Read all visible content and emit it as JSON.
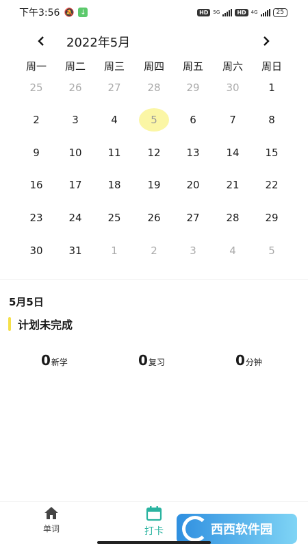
{
  "status": {
    "time": "下午3:56",
    "net_1": "5G",
    "net_2": "4G",
    "hd": "HD",
    "battery": "25"
  },
  "calendar": {
    "title": "2022年5月",
    "prev_arrow": "‹",
    "next_arrow": "›",
    "weekdays": [
      "周一",
      "周二",
      "周三",
      "周四",
      "周五",
      "周六",
      "周日"
    ],
    "selected_day": "5",
    "weeks": [
      [
        {
          "d": "25",
          "o": true
        },
        {
          "d": "26",
          "o": true
        },
        {
          "d": "27",
          "o": true
        },
        {
          "d": "28",
          "o": true
        },
        {
          "d": "29",
          "o": true
        },
        {
          "d": "30",
          "o": true
        },
        {
          "d": "1",
          "o": false
        }
      ],
      [
        {
          "d": "2",
          "o": false
        },
        {
          "d": "3",
          "o": false
        },
        {
          "d": "4",
          "o": false
        },
        {
          "d": "5",
          "o": false,
          "s": true
        },
        {
          "d": "6",
          "o": false
        },
        {
          "d": "7",
          "o": false
        },
        {
          "d": "8",
          "o": false
        }
      ],
      [
        {
          "d": "9",
          "o": false
        },
        {
          "d": "10",
          "o": false
        },
        {
          "d": "11",
          "o": false
        },
        {
          "d": "12",
          "o": false
        },
        {
          "d": "13",
          "o": false
        },
        {
          "d": "14",
          "o": false
        },
        {
          "d": "15",
          "o": false
        }
      ],
      [
        {
          "d": "16",
          "o": false
        },
        {
          "d": "17",
          "o": false
        },
        {
          "d": "18",
          "o": false
        },
        {
          "d": "19",
          "o": false
        },
        {
          "d": "20",
          "o": false
        },
        {
          "d": "21",
          "o": false
        },
        {
          "d": "22",
          "o": false
        }
      ],
      [
        {
          "d": "23",
          "o": false
        },
        {
          "d": "24",
          "o": false
        },
        {
          "d": "25",
          "o": false
        },
        {
          "d": "26",
          "o": false
        },
        {
          "d": "27",
          "o": false
        },
        {
          "d": "28",
          "o": false
        },
        {
          "d": "29",
          "o": false
        }
      ],
      [
        {
          "d": "30",
          "o": false
        },
        {
          "d": "31",
          "o": false
        },
        {
          "d": "1",
          "o": true
        },
        {
          "d": "2",
          "o": true
        },
        {
          "d": "3",
          "o": true
        },
        {
          "d": "4",
          "o": true
        },
        {
          "d": "5",
          "o": true
        }
      ]
    ]
  },
  "detail": {
    "date_label": "5月5日",
    "plan_status": "计划未完成",
    "stats": [
      {
        "value": "0",
        "unit": "新学"
      },
      {
        "value": "0",
        "unit": "复习"
      },
      {
        "value": "0",
        "unit": "分钟"
      }
    ]
  },
  "tabs": [
    {
      "label": "单词",
      "icon": "home-icon"
    },
    {
      "label": "打卡",
      "icon": "calendar-icon"
    }
  ],
  "watermark": {
    "text": "西西软件园"
  },
  "colors": {
    "accent": "#2ab3a0",
    "selected": "#fbf6a5",
    "plan_bar": "#f5e04a"
  }
}
